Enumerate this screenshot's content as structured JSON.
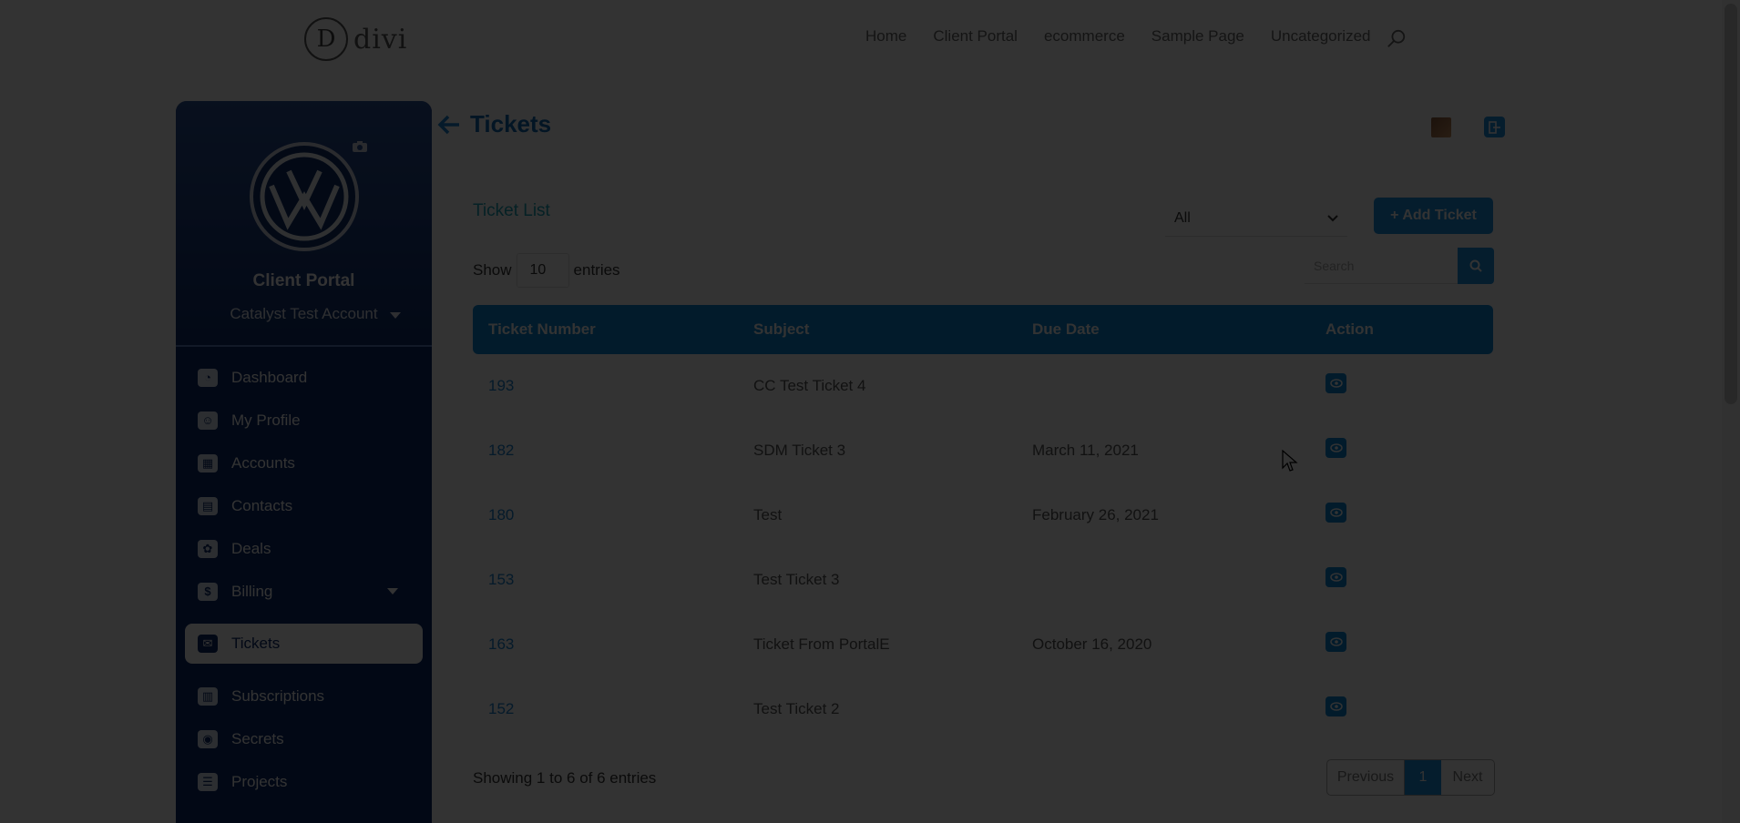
{
  "site": {
    "logo_letter": "D",
    "logo_text": "divi",
    "menu": [
      "Home",
      "Client Portal",
      "ecommerce",
      "Sample Page",
      "Uncategorized"
    ]
  },
  "sidebar": {
    "portal_title": "Client Portal",
    "account_name": "Catalyst Test Account",
    "items": [
      {
        "label": "Dashboard",
        "icon": "dashboard-icon",
        "glyph": "◔"
      },
      {
        "label": "My Profile",
        "icon": "user-icon",
        "glyph": "☺"
      },
      {
        "label": "Accounts",
        "icon": "building-icon",
        "glyph": "▦"
      },
      {
        "label": "Contacts",
        "icon": "contact-card-icon",
        "glyph": "▤"
      },
      {
        "label": "Deals",
        "icon": "handshake-icon",
        "glyph": "✿"
      },
      {
        "label": "Billing",
        "icon": "dollar-icon",
        "glyph": "$"
      },
      {
        "label": "Tickets",
        "icon": "ticket-icon",
        "glyph": "✉"
      },
      {
        "label": "Subscriptions",
        "icon": "calendar-icon",
        "glyph": "▥"
      },
      {
        "label": "Secrets",
        "icon": "lock-icon",
        "glyph": "◉"
      },
      {
        "label": "Projects",
        "icon": "project-icon",
        "glyph": "☰"
      }
    ]
  },
  "main": {
    "page_title": "Tickets",
    "list_title": "Ticket List",
    "filter_value": "All",
    "add_button_label": "+ Add Ticket",
    "show_label": "Show",
    "entries_value": "10",
    "entries_label": "entries",
    "search_placeholder": "Search",
    "columns": [
      "Ticket Number",
      "Subject",
      "Due Date",
      "Action"
    ],
    "rows": [
      {
        "number": "193",
        "subject": "CC Test Ticket 4",
        "due": ""
      },
      {
        "number": "182",
        "subject": "SDM Ticket 3",
        "due": "March 11, 2021"
      },
      {
        "number": "180",
        "subject": "Test",
        "due": "February 26, 2021"
      },
      {
        "number": "153",
        "subject": "Test Ticket 3",
        "due": ""
      },
      {
        "number": "163",
        "subject": "Ticket From PortalE",
        "due": "October 16, 2020"
      },
      {
        "number": "152",
        "subject": "Test Ticket 2",
        "due": ""
      }
    ],
    "footer_info": "Showing 1 to 6 of 6 entries",
    "pager": {
      "prev": "Previous",
      "page": "1",
      "next": "Next"
    }
  },
  "colors": {
    "sidebar_bg": "#0a2a6a",
    "accent": "#1a8fe0",
    "overlay": "rgba(0,0,0,0.8)"
  }
}
